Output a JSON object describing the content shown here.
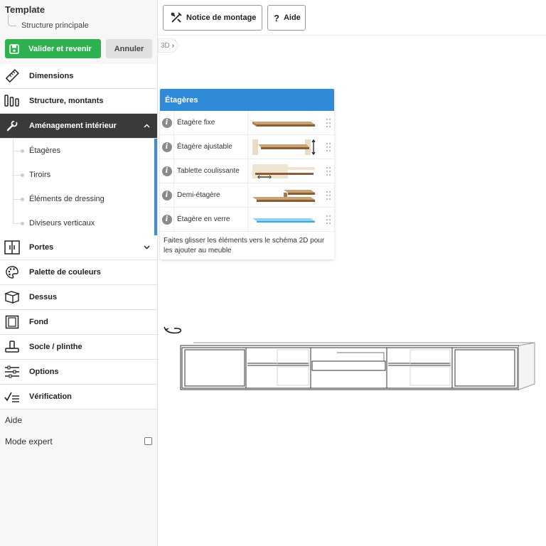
{
  "template": {
    "title": "Template",
    "subtitle": "Structure principale"
  },
  "actions": {
    "validate": "Valider et revenir",
    "cancel": "Annuler"
  },
  "menu": [
    {
      "label": "Dimensions",
      "icon": "ruler-icon"
    },
    {
      "label": "Structure, montants",
      "icon": "columns-icon"
    },
    {
      "label": "Aménagement intérieur",
      "icon": "wrench-icon",
      "active": true
    },
    {
      "label": "Portes",
      "icon": "doors-icon"
    },
    {
      "label": "Palette de couleurs",
      "icon": "palette-icon"
    },
    {
      "label": "Dessus",
      "icon": "top-box-icon"
    },
    {
      "label": "Fond",
      "icon": "back-panel-icon"
    },
    {
      "label": "Socle / plinthe",
      "icon": "plinth-icon"
    },
    {
      "label": "Options",
      "icon": "sliders-icon"
    },
    {
      "label": "Vérification",
      "icon": "checklist-icon"
    }
  ],
  "submenu": [
    "Étagères",
    "Tiroirs",
    "Éléments de dressing",
    "Diviseurs verticaux"
  ],
  "sidebar_footer": {
    "help": "Aide",
    "expert_mode": "Mode expert",
    "expert_checked": false
  },
  "toolbar": {
    "assembly": "Notice de montage",
    "help": "Aide"
  },
  "breadcrumb": "3D",
  "panel": {
    "title": "Étagères",
    "items": [
      {
        "label": "Étagère fixe"
      },
      {
        "label": "Étagère ajustable"
      },
      {
        "label": "Tablette coulissante"
      },
      {
        "label": "Demi-étagère"
      },
      {
        "label": "Étagère en verre"
      }
    ],
    "hint": "Faites glisser les éléments vers le schéma 2D pour les ajouter au meuble"
  },
  "colors": {
    "accent": "#2f8ad8",
    "validate": "#2eb24f",
    "active_menu": "#3a3a3a",
    "wood": "#a67a4c",
    "glass": "#7cc8f0"
  }
}
